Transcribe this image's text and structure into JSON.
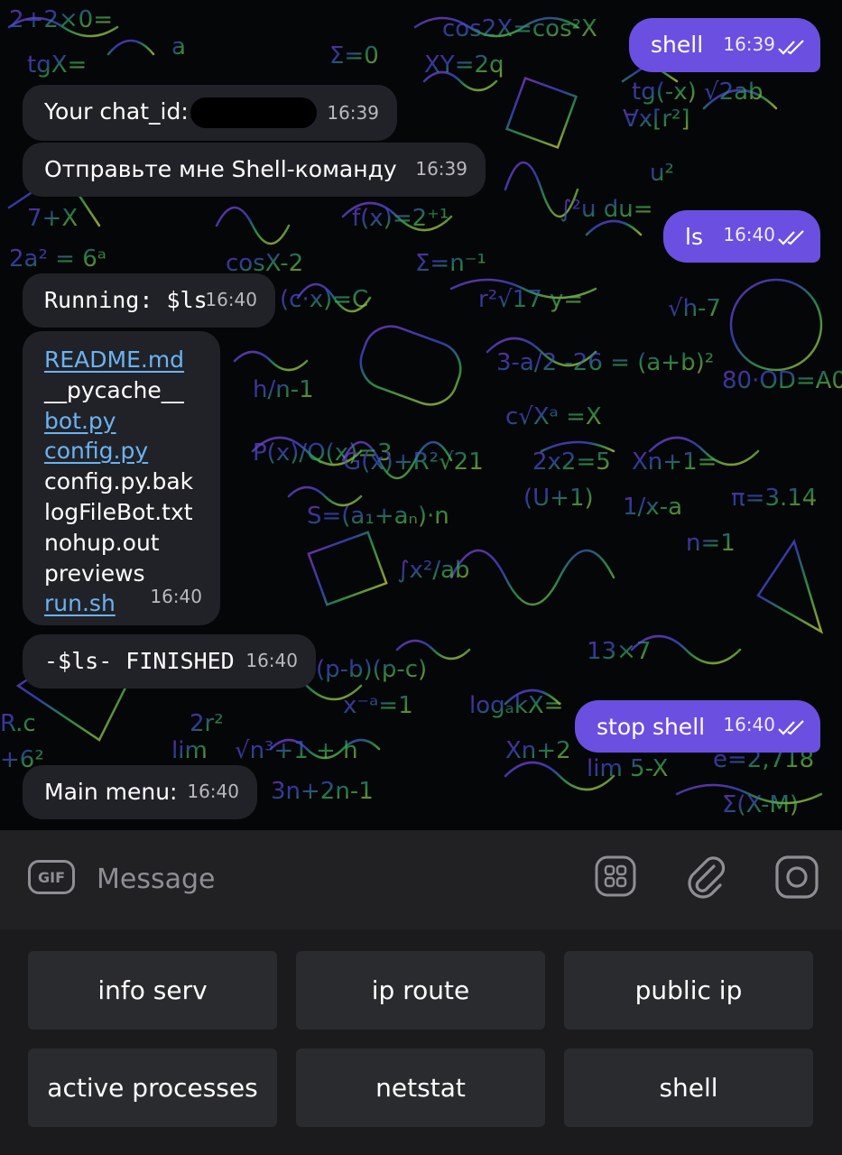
{
  "messages": {
    "m1": {
      "text": "shell",
      "time": "16:39"
    },
    "m2": {
      "text": "Your chat_id:",
      "time": "16:39"
    },
    "m3": {
      "text": "Отправьте мне Shell-команду",
      "time": "16:39"
    },
    "m4": {
      "text": "ls",
      "time": "16:40"
    },
    "m5": {
      "text": "Running: $ls",
      "time": "16:40"
    },
    "m6": {
      "files": [
        "README.md",
        "__pycache__",
        "bot.py",
        "config.py",
        "config.py.bak",
        "logFileBot.txt",
        "nohup.out",
        "previews",
        "run.sh"
      ],
      "time": "16:40"
    },
    "m7": {
      "text": "-$ls- FINISHED",
      "time": "16:40"
    },
    "m8": {
      "text": "stop shell",
      "time": "16:40"
    },
    "m9": {
      "text": "Main menu:",
      "time": "16:40"
    }
  },
  "composer": {
    "placeholder": "Message",
    "gif_label": "GIF"
  },
  "keyboard": {
    "row1": [
      "info serv",
      "ip route",
      "public ip"
    ],
    "row2": [
      "active processes",
      "netstat",
      "shell"
    ]
  },
  "colors": {
    "outgoing_bubble": "#6b4fe0",
    "incoming_bubble": "#212227",
    "link": "#6ab3f3",
    "keyboard_button": "#2a2b2f"
  },
  "icons": [
    "gif-icon",
    "sticker-icon",
    "attach-icon",
    "camera-icon",
    "double-check-icon"
  ]
}
